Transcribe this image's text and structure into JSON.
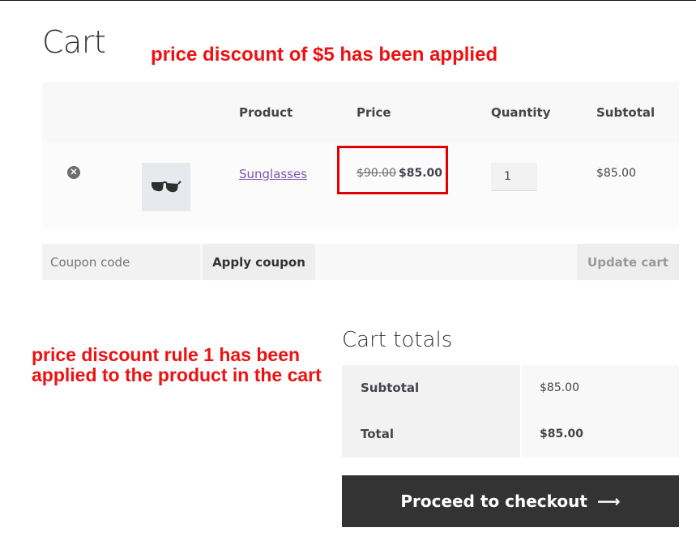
{
  "page": {
    "title": "Cart"
  },
  "annotations": {
    "top": "price discount of $5 has been applied",
    "bottom": "price discount rule 1 has been applied to the product in the cart"
  },
  "cart": {
    "headers": {
      "product": "Product",
      "price": "Price",
      "quantity": "Quantity",
      "subtotal": "Subtotal"
    },
    "items": [
      {
        "name": "Sunglasses",
        "price_original": "$90.00",
        "price_discounted": "$85.00",
        "quantity": "1",
        "subtotal": "$85.00"
      }
    ],
    "coupon_placeholder": "Coupon code",
    "apply_coupon_label": "Apply coupon",
    "update_cart_label": "Update cart"
  },
  "totals": {
    "title": "Cart totals",
    "subtotal_label": "Subtotal",
    "subtotal_value": "$85.00",
    "total_label": "Total",
    "total_value": "$85.00"
  },
  "checkout": {
    "label": "Proceed to checkout",
    "icon": "arrow-right-icon"
  },
  "colors": {
    "annotation": "#ee1111",
    "link": "#7f54b3",
    "checkout_bg": "#333333"
  }
}
